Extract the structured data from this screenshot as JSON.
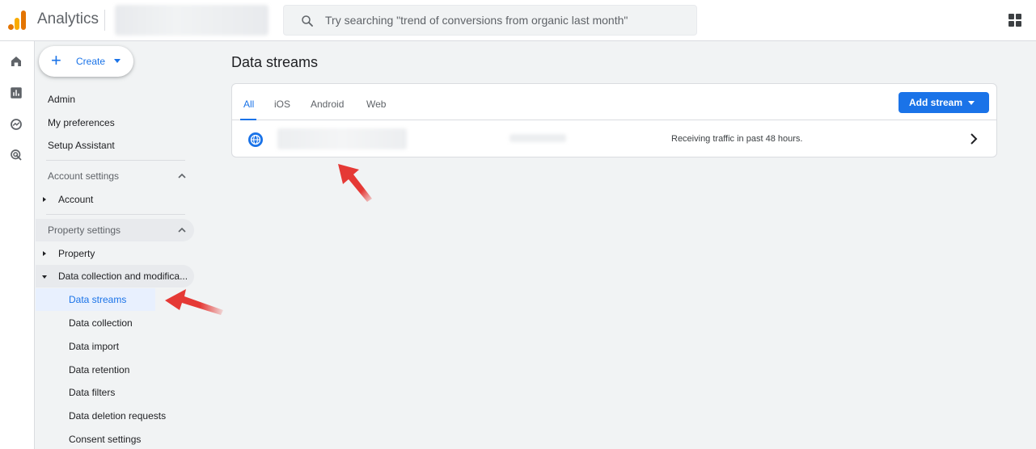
{
  "header": {
    "app_title": "Analytics",
    "search_placeholder": "Try searching \"trend of conversions from organic last month\""
  },
  "nav": {
    "create_label": "Create",
    "top_items": [
      "Admin",
      "My preferences",
      "Setup Assistant"
    ],
    "account_settings": {
      "title": "Account settings",
      "items": [
        "Account"
      ]
    },
    "property_settings": {
      "title": "Property settings",
      "items": [
        "Property",
        "Data collection and modifica..."
      ]
    },
    "sub_items": [
      "Data streams",
      "Data collection",
      "Data import",
      "Data retention",
      "Data filters",
      "Data deletion requests",
      "Consent settings"
    ]
  },
  "main": {
    "title": "Data streams",
    "tabs": [
      "All",
      "iOS",
      "Android",
      "Web"
    ],
    "active_tab": "All",
    "add_stream_label": "Add stream",
    "stream": {
      "status": "Receiving traffic in past 48 hours."
    }
  },
  "colors": {
    "accent": "#1a73e8",
    "arrow": "#e53935"
  }
}
